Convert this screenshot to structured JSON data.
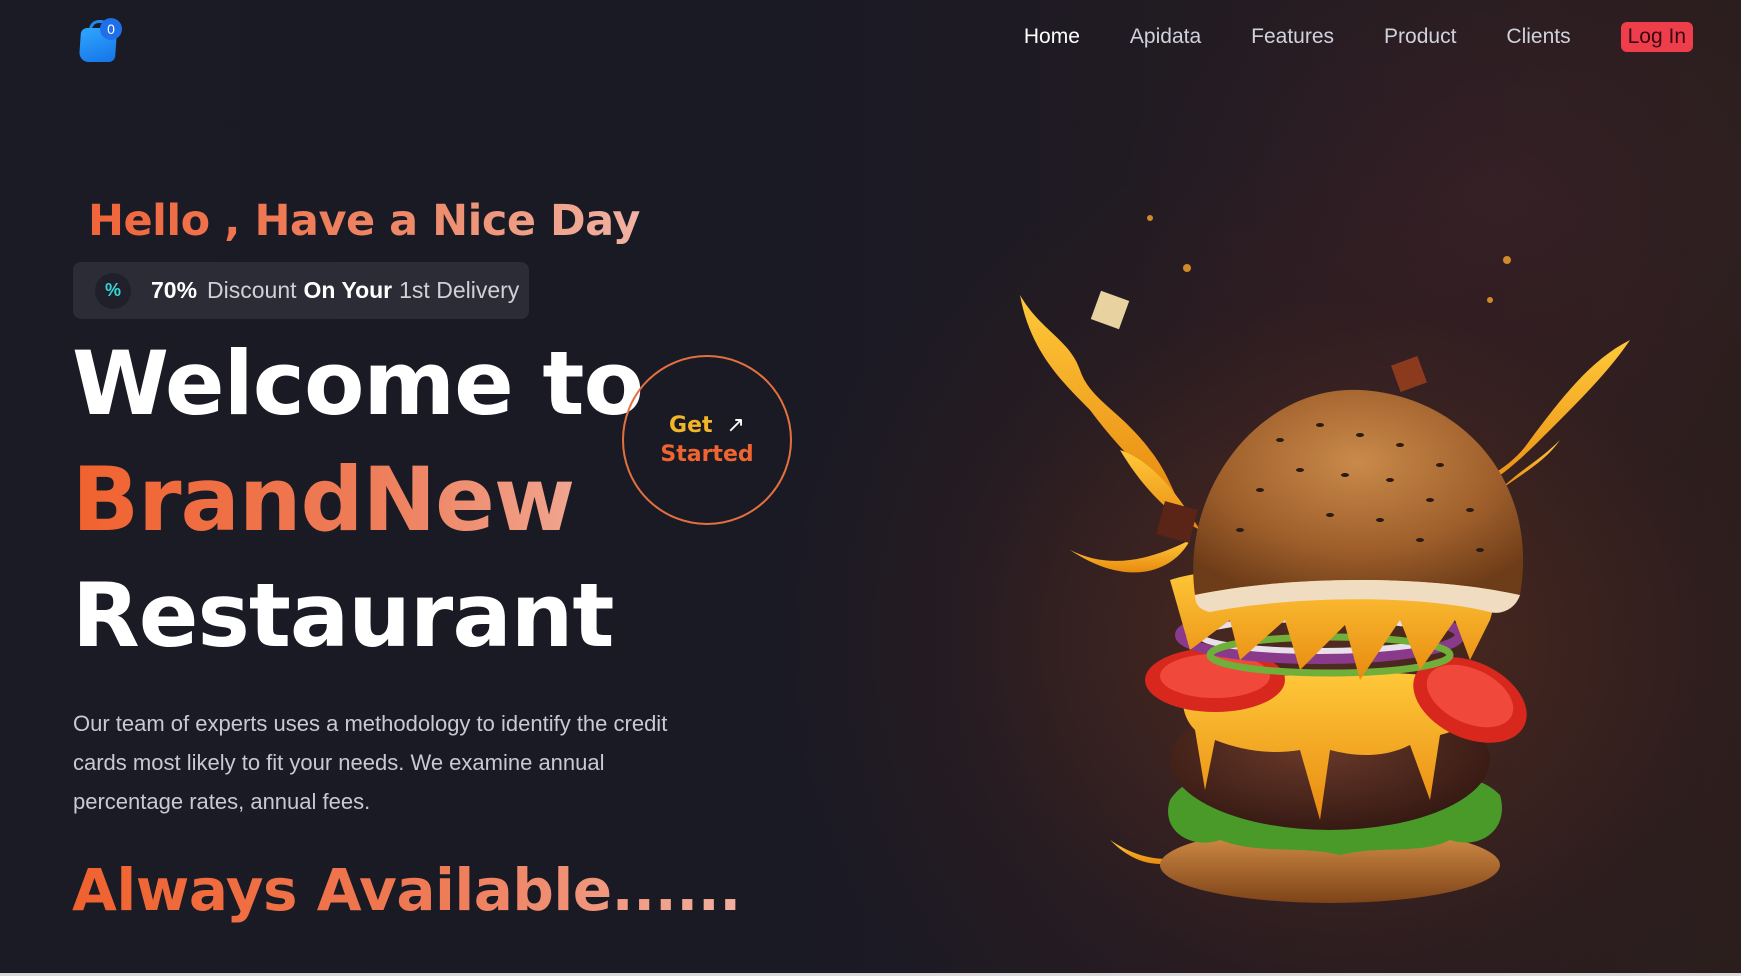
{
  "nav": {
    "cart_count": "0",
    "items": [
      {
        "label": "Home",
        "active": true
      },
      {
        "label": "Apidata"
      },
      {
        "label": "Features"
      },
      {
        "label": "Product"
      },
      {
        "label": "Clients"
      }
    ],
    "login_label": "Log In"
  },
  "hero": {
    "greeting": "Hello , Have a Nice Day",
    "discount": {
      "percent": "70%",
      "word1": "Discount",
      "word2": "On Your",
      "word3": "1st Delivery",
      "icon": "percent-icon"
    },
    "headline_1": "Welcome to",
    "headline_2": "BrandNew",
    "headline_3": "Restaurant",
    "cta_line1": "Get",
    "cta_line2": "Started",
    "cta_icon": "arrow-up-right-icon",
    "description": "Our team of experts uses a methodology to identify the credit cards most likely to fit your needs. We examine annual percentage rates, annual fees.",
    "tagline": "Always Available......"
  },
  "colors": {
    "accent_orange": "#ee6530",
    "cta_yellow": "#f0b528",
    "login_red": "#ee3e4c",
    "cart_blue": "#1f6fe8"
  }
}
